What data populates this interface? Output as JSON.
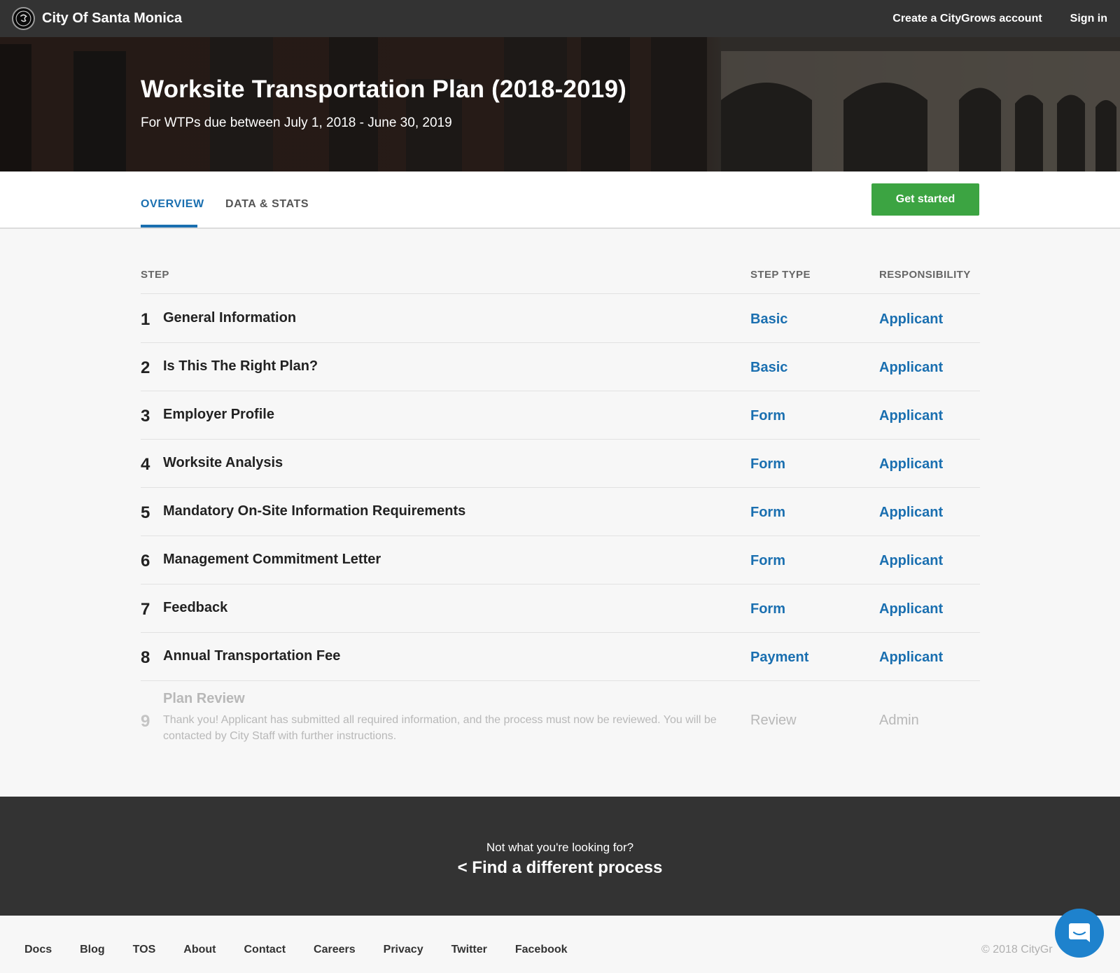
{
  "topnav": {
    "brand": "City Of Santa Monica",
    "logo_icon": "city-seal-icon",
    "create_account": "Create a CityGrows account",
    "sign_in": "Sign in"
  },
  "hero": {
    "title": "Worksite Transportation Plan (2018-2019)",
    "subtitle": "For WTPs due between July 1, 2018 - June 30, 2019"
  },
  "tabs": [
    {
      "label": "OVERVIEW",
      "active": true
    },
    {
      "label": "DATA & STATS",
      "active": false
    }
  ],
  "get_started_label": "Get started",
  "table": {
    "headers": {
      "step": "STEP",
      "type": "STEP TYPE",
      "responsibility": "RESPONSIBILITY"
    },
    "rows": [
      {
        "num": "1",
        "name": "General Information",
        "type": "Basic",
        "responsibility": "Applicant"
      },
      {
        "num": "2",
        "name": "Is This The Right Plan?",
        "type": "Basic",
        "responsibility": "Applicant"
      },
      {
        "num": "3",
        "name": "Employer Profile",
        "type": "Form",
        "responsibility": "Applicant"
      },
      {
        "num": "4",
        "name": "Worksite Analysis",
        "type": "Form",
        "responsibility": "Applicant"
      },
      {
        "num": "5",
        "name": "Mandatory On-Site Information Requirements",
        "type": "Form",
        "responsibility": "Applicant"
      },
      {
        "num": "6",
        "name": "Management Commitment Letter",
        "type": "Form",
        "responsibility": "Applicant"
      },
      {
        "num": "7",
        "name": "Feedback",
        "type": "Form",
        "responsibility": "Applicant"
      },
      {
        "num": "8",
        "name": "Annual Transportation Fee",
        "type": "Payment",
        "responsibility": "Applicant"
      }
    ],
    "final_row": {
      "num": "9",
      "name": "Plan Review",
      "description": "Thank you! Applicant has submitted all required information, and the process must now be reviewed. You will be contacted by City Staff with further instructions.",
      "type": "Review",
      "responsibility": "Admin"
    }
  },
  "findband": {
    "question": "Not what you're looking for?",
    "link": "< Find a different process"
  },
  "footer": {
    "links": [
      "Docs",
      "Blog",
      "TOS",
      "About",
      "Contact",
      "Careers",
      "Privacy",
      "Twitter",
      "Facebook"
    ],
    "copyright": "© 2018 CityGr"
  },
  "chat_icon": "chat-bubble-icon",
  "colors": {
    "nav_bg": "#333333",
    "accent_blue": "#1a6fb0",
    "button_green": "#3ca442",
    "chat_blue": "#1e82cd"
  }
}
